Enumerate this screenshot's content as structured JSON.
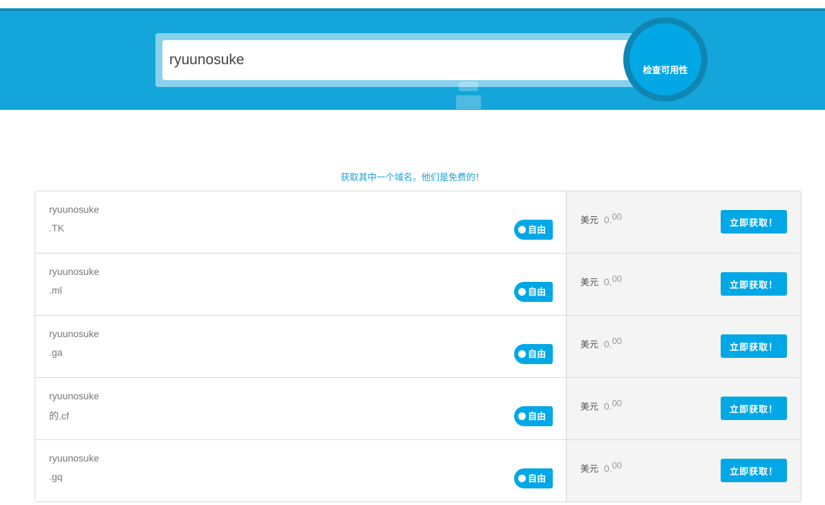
{
  "search": {
    "value": "ryuunosuke",
    "button_label": "检查可用性"
  },
  "promo_text": "获取其中一个域名。他们是免费的！",
  "results": [
    {
      "name": "ryuunosuke",
      "tld": ".TK",
      "badge": "自由",
      "currency": "美元",
      "price_int": "0.",
      "price_dec": "00",
      "button": "立即获取！"
    },
    {
      "name": "ryuunosuke",
      "tld": ".ml",
      "badge": "自由",
      "currency": "美元",
      "price_int": "0.",
      "price_dec": "00",
      "button": "立即获取！"
    },
    {
      "name": "ryuunosuke",
      "tld": ".ga",
      "badge": "自由",
      "currency": "美元",
      "price_int": "0.",
      "price_dec": "00",
      "button": "立即获取！"
    },
    {
      "name": "ryuunosuke",
      "tld": "的.cf",
      "badge": "自由",
      "currency": "美元",
      "price_int": "0.",
      "price_dec": "00",
      "button": "立即获取！"
    },
    {
      "name": "ryuunosuke",
      "tld": ".gq",
      "badge": "自由",
      "currency": "美元",
      "price_int": "0.",
      "price_dec": "00",
      "button": "立即获取！"
    }
  ],
  "colors": {
    "hero": "#14a5da",
    "accent": "#02a8e6",
    "promo": "#1aa0d8"
  }
}
